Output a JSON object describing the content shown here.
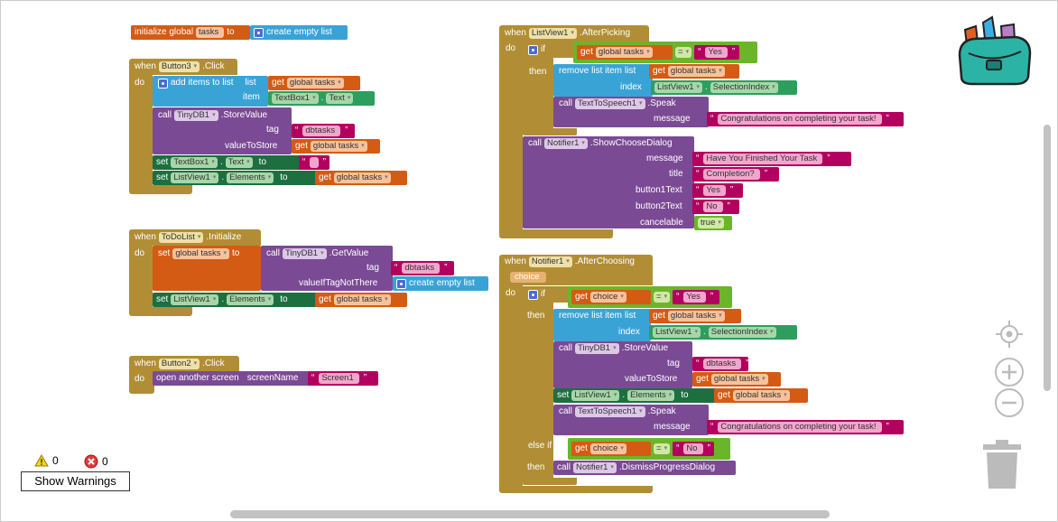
{
  "init_block": {
    "initialize": "initialize global",
    "var": "tasks",
    "to": "to",
    "create": "create empty list"
  },
  "button3_block": {
    "when": "when",
    "component": "Button3",
    "event": ".Click",
    "do": "do",
    "add_items": "add items to list",
    "list_lbl": "list",
    "get": "get",
    "global_tasks": "global tasks",
    "item_lbl": "item",
    "textbox1": "TextBox1",
    "dot": ".",
    "text_prop": "Text",
    "call": "call",
    "tinydb1": "TinyDB1",
    "storevalue": ".StoreValue",
    "tag_lbl": "tag",
    "tag_val": "dbtasks",
    "value_to_store": "valueToStore",
    "set": "set",
    "to": "to",
    "empty_str": "",
    "listview1": "ListView1",
    "elements": "Elements"
  },
  "todolist_block": {
    "when": "when",
    "component": "ToDoList",
    "event": ".Initialize",
    "do": "do",
    "set": "set",
    "global_tasks": "global tasks",
    "to": "to",
    "call": "call",
    "tinydb1": "TinyDB1",
    "getvalue": ".GetValue",
    "tag_lbl": "tag",
    "tag_val": "dbtasks",
    "if_not_there": "valueIfTagNotThere",
    "create": "create empty list",
    "listview1": "ListView1",
    "dot": ".",
    "elements": "Elements",
    "get": "get"
  },
  "button2_block": {
    "when": "when",
    "component": "Button2",
    "event": ".Click",
    "do": "do",
    "open_screen": "open another screen",
    "screen_name": "screenName",
    "screen_val": "Screen1"
  },
  "afterpicking_block": {
    "when": "when",
    "component": "ListView1",
    "event": ".AfterPicking",
    "do": "do",
    "if": "if",
    "get": "get",
    "global_tasks": "global tasks",
    "eq": "=",
    "yes": "Yes",
    "then": "then",
    "remove": "remove list item",
    "list_lbl": "list",
    "index_lbl": "index",
    "listview1": "ListView1",
    "dot": ".",
    "selection_index": "SelectionIndex",
    "call": "call",
    "tts": "TextToSpeech1",
    "speak": ".Speak",
    "message_lbl": "message",
    "congrats": "Congratulations on completing your task!",
    "notifier": "Notifier1",
    "show_choose": ".ShowChooseDialog",
    "msg_val": "Have You Finished Your Task",
    "title_lbl": "title",
    "title_val": "Completion?",
    "b1_lbl": "button1Text",
    "b1_val": "Yes",
    "b2_lbl": "button2Text",
    "b2_val": "No",
    "cancelable_lbl": "cancelable",
    "cancelable_val": "true"
  },
  "afterchoosing_block": {
    "when": "when",
    "component": "Notifier1",
    "event": ".AfterChoosing",
    "param": "choice",
    "do": "do",
    "if": "if",
    "get": "get",
    "choice": "choice",
    "eq": "=",
    "yes": "Yes",
    "then": "then",
    "remove": "remove list item",
    "list_lbl": "list",
    "global_tasks": "global tasks",
    "index_lbl": "index",
    "listview1": "ListView1",
    "dot": ".",
    "selection_index": "SelectionIndex",
    "call": "call",
    "tinydb1": "TinyDB1",
    "storevalue": ".StoreValue",
    "tag_lbl": "tag",
    "tag_val": "dbtasks",
    "value_to_store": "valueToStore",
    "set": "set",
    "elements": "Elements",
    "to": "to",
    "tts": "TextToSpeech1",
    "speak": ".Speak",
    "message_lbl": "message",
    "congrats": "Congratulations on completing your task!",
    "else_if": "else if",
    "no": "No",
    "notifier": "Notifier1",
    "dismiss": ".DismissProgressDialog"
  },
  "warnings": {
    "warning_count": "0",
    "error_count": "0",
    "show_label": "Show Warnings"
  }
}
